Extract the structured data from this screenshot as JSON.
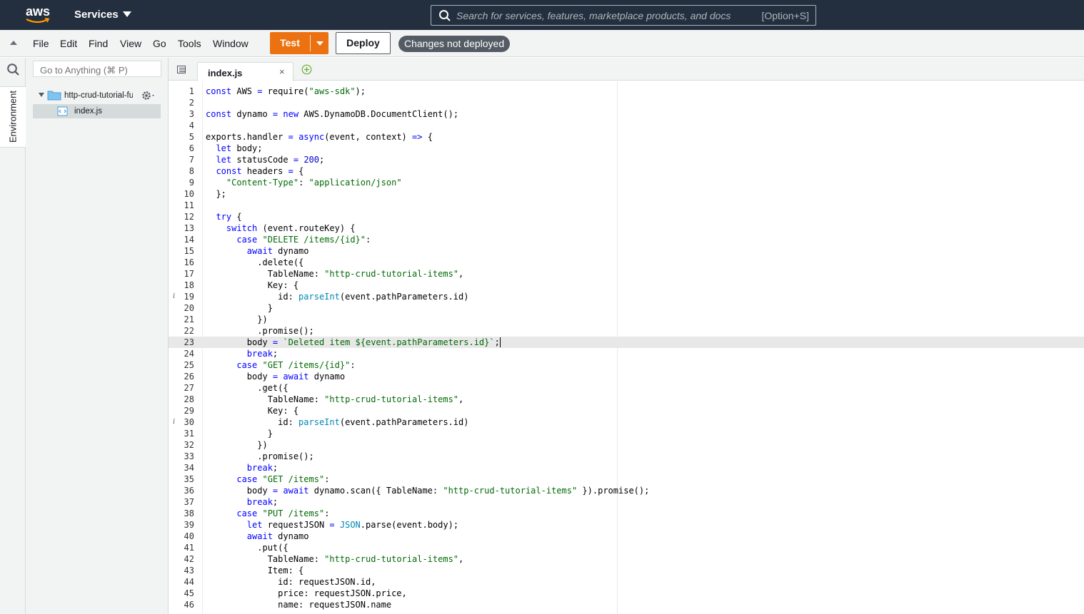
{
  "topnav": {
    "logo_text": "aws",
    "services_label": "Services",
    "search_placeholder": "Search for services, features, marketplace products, and docs",
    "search_shortcut": "[Option+S]"
  },
  "menubar": {
    "items": [
      "File",
      "Edit",
      "Find",
      "View",
      "Go",
      "Tools",
      "Window"
    ],
    "test_label": "Test",
    "deploy_label": "Deploy",
    "changes_badge": "Changes not deployed"
  },
  "sidebar": {
    "environment_label": "Environment",
    "goto_placeholder": "Go to Anything (⌘ P)",
    "folder_name": "http-crud-tutorial-function",
    "file_name": "index.js"
  },
  "editor": {
    "tab_name": "index.js",
    "active_line": 23,
    "lines": [
      "const AWS = require(\"aws-sdk\");",
      "",
      "const dynamo = new AWS.DynamoDB.DocumentClient();",
      "",
      "exports.handler = async(event, context) => {",
      "  let body;",
      "  let statusCode = 200;",
      "  const headers = {",
      "    \"Content-Type\": \"application/json\"",
      "  };",
      "",
      "  try {",
      "    switch (event.routeKey) {",
      "      case \"DELETE /items/{id}\":",
      "        await dynamo",
      "          .delete({",
      "            TableName: \"http-crud-tutorial-items\",",
      "            Key: {",
      "              id: parseInt(event.pathParameters.id)",
      "            }",
      "          })",
      "          .promise();",
      "        body = `Deleted item ${event.pathParameters.id}`;",
      "        break;",
      "      case \"GET /items/{id}\":",
      "        body = await dynamo",
      "          .get({",
      "            TableName: \"http-crud-tutorial-items\",",
      "            Key: {",
      "              id: parseInt(event.pathParameters.id)",
      "            }",
      "          })",
      "          .promise();",
      "        break;",
      "      case \"GET /items\":",
      "        body = await dynamo.scan({ TableName: \"http-crud-tutorial-items\" }).promise();",
      "        break;",
      "      case \"PUT /items\":",
      "        let requestJSON = JSON.parse(event.body);",
      "        await dynamo",
      "          .put({",
      "            TableName: \"http-crud-tutorial-items\",",
      "            Item: {",
      "              id: requestJSON.id,",
      "              price: requestJSON.price,",
      "              name: requestJSON.name"
    ],
    "info_lines": [
      19,
      30
    ]
  },
  "colors": {
    "nav_bg": "#232f3e",
    "accent_orange": "#ec7211",
    "keyword": "#0000ff",
    "string": "#036a07"
  }
}
